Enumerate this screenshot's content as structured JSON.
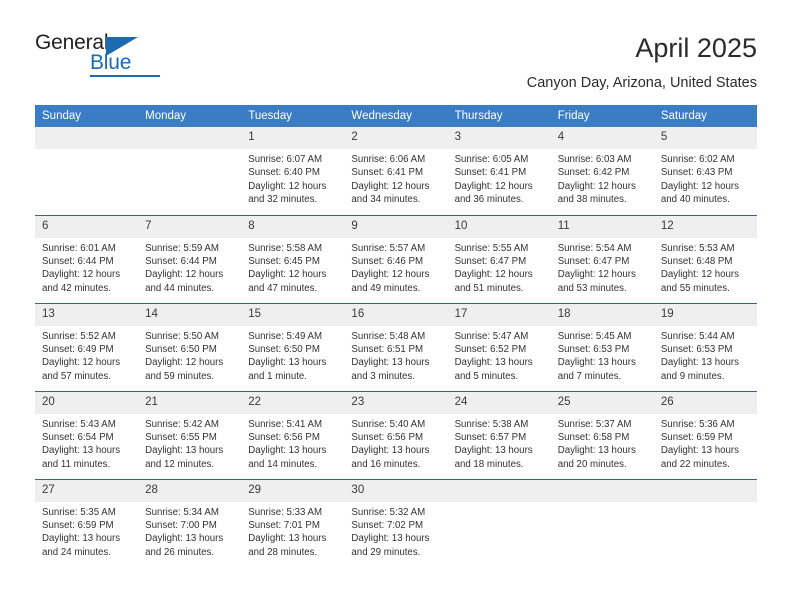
{
  "brand": {
    "name_part1": "General",
    "name_part2": "Blue",
    "accent_color": "#1c6bb0"
  },
  "header": {
    "month_title": "April 2025",
    "location": "Canyon Day, Arizona, United States"
  },
  "calendar": {
    "header_color": "#3b7dc4",
    "daynum_background": "#efefef",
    "weekdays": [
      "Sunday",
      "Monday",
      "Tuesday",
      "Wednesday",
      "Thursday",
      "Friday",
      "Saturday"
    ],
    "weeks": [
      [
        {
          "day": "",
          "empty": true
        },
        {
          "day": "",
          "empty": true
        },
        {
          "day": "1",
          "sunrise": "Sunrise: 6:07 AM",
          "sunset": "Sunset: 6:40 PM",
          "daylight": "Daylight: 12 hours and 32 minutes."
        },
        {
          "day": "2",
          "sunrise": "Sunrise: 6:06 AM",
          "sunset": "Sunset: 6:41 PM",
          "daylight": "Daylight: 12 hours and 34 minutes."
        },
        {
          "day": "3",
          "sunrise": "Sunrise: 6:05 AM",
          "sunset": "Sunset: 6:41 PM",
          "daylight": "Daylight: 12 hours and 36 minutes."
        },
        {
          "day": "4",
          "sunrise": "Sunrise: 6:03 AM",
          "sunset": "Sunset: 6:42 PM",
          "daylight": "Daylight: 12 hours and 38 minutes."
        },
        {
          "day": "5",
          "sunrise": "Sunrise: 6:02 AM",
          "sunset": "Sunset: 6:43 PM",
          "daylight": "Daylight: 12 hours and 40 minutes."
        }
      ],
      [
        {
          "day": "6",
          "sunrise": "Sunrise: 6:01 AM",
          "sunset": "Sunset: 6:44 PM",
          "daylight": "Daylight: 12 hours and 42 minutes."
        },
        {
          "day": "7",
          "sunrise": "Sunrise: 5:59 AM",
          "sunset": "Sunset: 6:44 PM",
          "daylight": "Daylight: 12 hours and 44 minutes."
        },
        {
          "day": "8",
          "sunrise": "Sunrise: 5:58 AM",
          "sunset": "Sunset: 6:45 PM",
          "daylight": "Daylight: 12 hours and 47 minutes."
        },
        {
          "day": "9",
          "sunrise": "Sunrise: 5:57 AM",
          "sunset": "Sunset: 6:46 PM",
          "daylight": "Daylight: 12 hours and 49 minutes."
        },
        {
          "day": "10",
          "sunrise": "Sunrise: 5:55 AM",
          "sunset": "Sunset: 6:47 PM",
          "daylight": "Daylight: 12 hours and 51 minutes."
        },
        {
          "day": "11",
          "sunrise": "Sunrise: 5:54 AM",
          "sunset": "Sunset: 6:47 PM",
          "daylight": "Daylight: 12 hours and 53 minutes."
        },
        {
          "day": "12",
          "sunrise": "Sunrise: 5:53 AM",
          "sunset": "Sunset: 6:48 PM",
          "daylight": "Daylight: 12 hours and 55 minutes."
        }
      ],
      [
        {
          "day": "13",
          "sunrise": "Sunrise: 5:52 AM",
          "sunset": "Sunset: 6:49 PM",
          "daylight": "Daylight: 12 hours and 57 minutes."
        },
        {
          "day": "14",
          "sunrise": "Sunrise: 5:50 AM",
          "sunset": "Sunset: 6:50 PM",
          "daylight": "Daylight: 12 hours and 59 minutes."
        },
        {
          "day": "15",
          "sunrise": "Sunrise: 5:49 AM",
          "sunset": "Sunset: 6:50 PM",
          "daylight": "Daylight: 13 hours and 1 minute."
        },
        {
          "day": "16",
          "sunrise": "Sunrise: 5:48 AM",
          "sunset": "Sunset: 6:51 PM",
          "daylight": "Daylight: 13 hours and 3 minutes."
        },
        {
          "day": "17",
          "sunrise": "Sunrise: 5:47 AM",
          "sunset": "Sunset: 6:52 PM",
          "daylight": "Daylight: 13 hours and 5 minutes."
        },
        {
          "day": "18",
          "sunrise": "Sunrise: 5:45 AM",
          "sunset": "Sunset: 6:53 PM",
          "daylight": "Daylight: 13 hours and 7 minutes."
        },
        {
          "day": "19",
          "sunrise": "Sunrise: 5:44 AM",
          "sunset": "Sunset: 6:53 PM",
          "daylight": "Daylight: 13 hours and 9 minutes."
        }
      ],
      [
        {
          "day": "20",
          "sunrise": "Sunrise: 5:43 AM",
          "sunset": "Sunset: 6:54 PM",
          "daylight": "Daylight: 13 hours and 11 minutes."
        },
        {
          "day": "21",
          "sunrise": "Sunrise: 5:42 AM",
          "sunset": "Sunset: 6:55 PM",
          "daylight": "Daylight: 13 hours and 12 minutes."
        },
        {
          "day": "22",
          "sunrise": "Sunrise: 5:41 AM",
          "sunset": "Sunset: 6:56 PM",
          "daylight": "Daylight: 13 hours and 14 minutes."
        },
        {
          "day": "23",
          "sunrise": "Sunrise: 5:40 AM",
          "sunset": "Sunset: 6:56 PM",
          "daylight": "Daylight: 13 hours and 16 minutes."
        },
        {
          "day": "24",
          "sunrise": "Sunrise: 5:38 AM",
          "sunset": "Sunset: 6:57 PM",
          "daylight": "Daylight: 13 hours and 18 minutes."
        },
        {
          "day": "25",
          "sunrise": "Sunrise: 5:37 AM",
          "sunset": "Sunset: 6:58 PM",
          "daylight": "Daylight: 13 hours and 20 minutes."
        },
        {
          "day": "26",
          "sunrise": "Sunrise: 5:36 AM",
          "sunset": "Sunset: 6:59 PM",
          "daylight": "Daylight: 13 hours and 22 minutes."
        }
      ],
      [
        {
          "day": "27",
          "sunrise": "Sunrise: 5:35 AM",
          "sunset": "Sunset: 6:59 PM",
          "daylight": "Daylight: 13 hours and 24 minutes."
        },
        {
          "day": "28",
          "sunrise": "Sunrise: 5:34 AM",
          "sunset": "Sunset: 7:00 PM",
          "daylight": "Daylight: 13 hours and 26 minutes."
        },
        {
          "day": "29",
          "sunrise": "Sunrise: 5:33 AM",
          "sunset": "Sunset: 7:01 PM",
          "daylight": "Daylight: 13 hours and 28 minutes."
        },
        {
          "day": "30",
          "sunrise": "Sunrise: 5:32 AM",
          "sunset": "Sunset: 7:02 PM",
          "daylight": "Daylight: 13 hours and 29 minutes."
        },
        {
          "day": "",
          "empty": true
        },
        {
          "day": "",
          "empty": true
        },
        {
          "day": "",
          "empty": true
        }
      ]
    ]
  }
}
